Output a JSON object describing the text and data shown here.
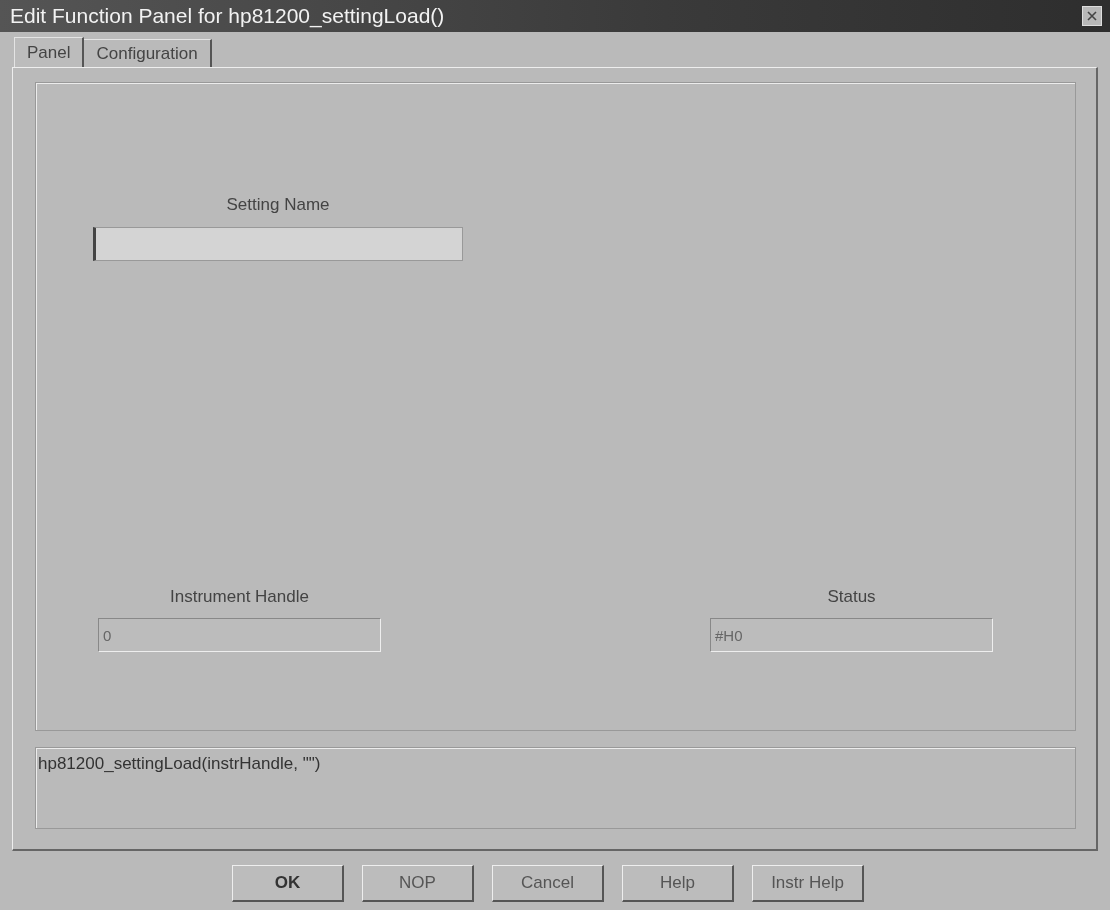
{
  "window": {
    "title": "Edit Function Panel for hp81200_settingLoad()"
  },
  "tabs": [
    {
      "label": "Panel",
      "selected": true
    },
    {
      "label": "Configuration",
      "selected": false
    }
  ],
  "setting_name": {
    "label": "Setting Name",
    "disabled": false
  },
  "instrument_handle": {
    "label": "Instrument Handle",
    "value": "0",
    "disabled": true
  },
  "status": {
    "label": "Status",
    "value": "#H0",
    "disabled": true
  },
  "function_call": "hp81200_settingLoad(instrHandle, \"\")",
  "buttons": [
    {
      "label": "OK",
      "default": true
    },
    {
      "label": "NOP",
      "default": false
    },
    {
      "label": "Cancel",
      "default": false
    },
    {
      "label": "Help",
      "default": false
    },
    {
      "label": "Instr Help",
      "default": false
    }
  ]
}
